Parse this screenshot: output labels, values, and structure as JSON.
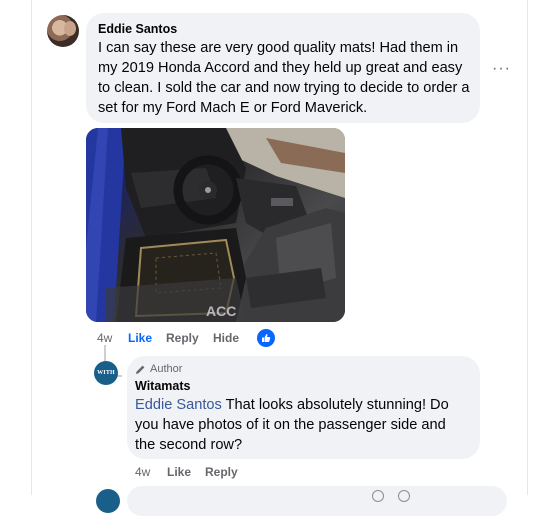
{
  "comment": {
    "author": "Eddie Santos",
    "text": "I can say these are very good quality mats! Had them in my 2019 Honda Accord and they held up great and easy to clean. I sold the car and now trying to decide to order a set for my Ford Mach E or Ford Maverick.",
    "more_label": "···",
    "actions": {
      "time": "4w",
      "like": "Like",
      "reply": "Reply",
      "hide": "Hide"
    }
  },
  "reply": {
    "badge": "Author",
    "author": "Witamats",
    "avatar_text": "WITH",
    "mention": "Eddie Santos",
    "text": " That looks absolutely stunning! Do you have photos of it on the passenger side and the second row?",
    "actions": {
      "time": "4w",
      "like": "Like",
      "reply": "Reply"
    }
  },
  "colors": {
    "like_blue": "#0866ff",
    "bubble_bg": "#f0f2f5",
    "mention": "#385898"
  }
}
